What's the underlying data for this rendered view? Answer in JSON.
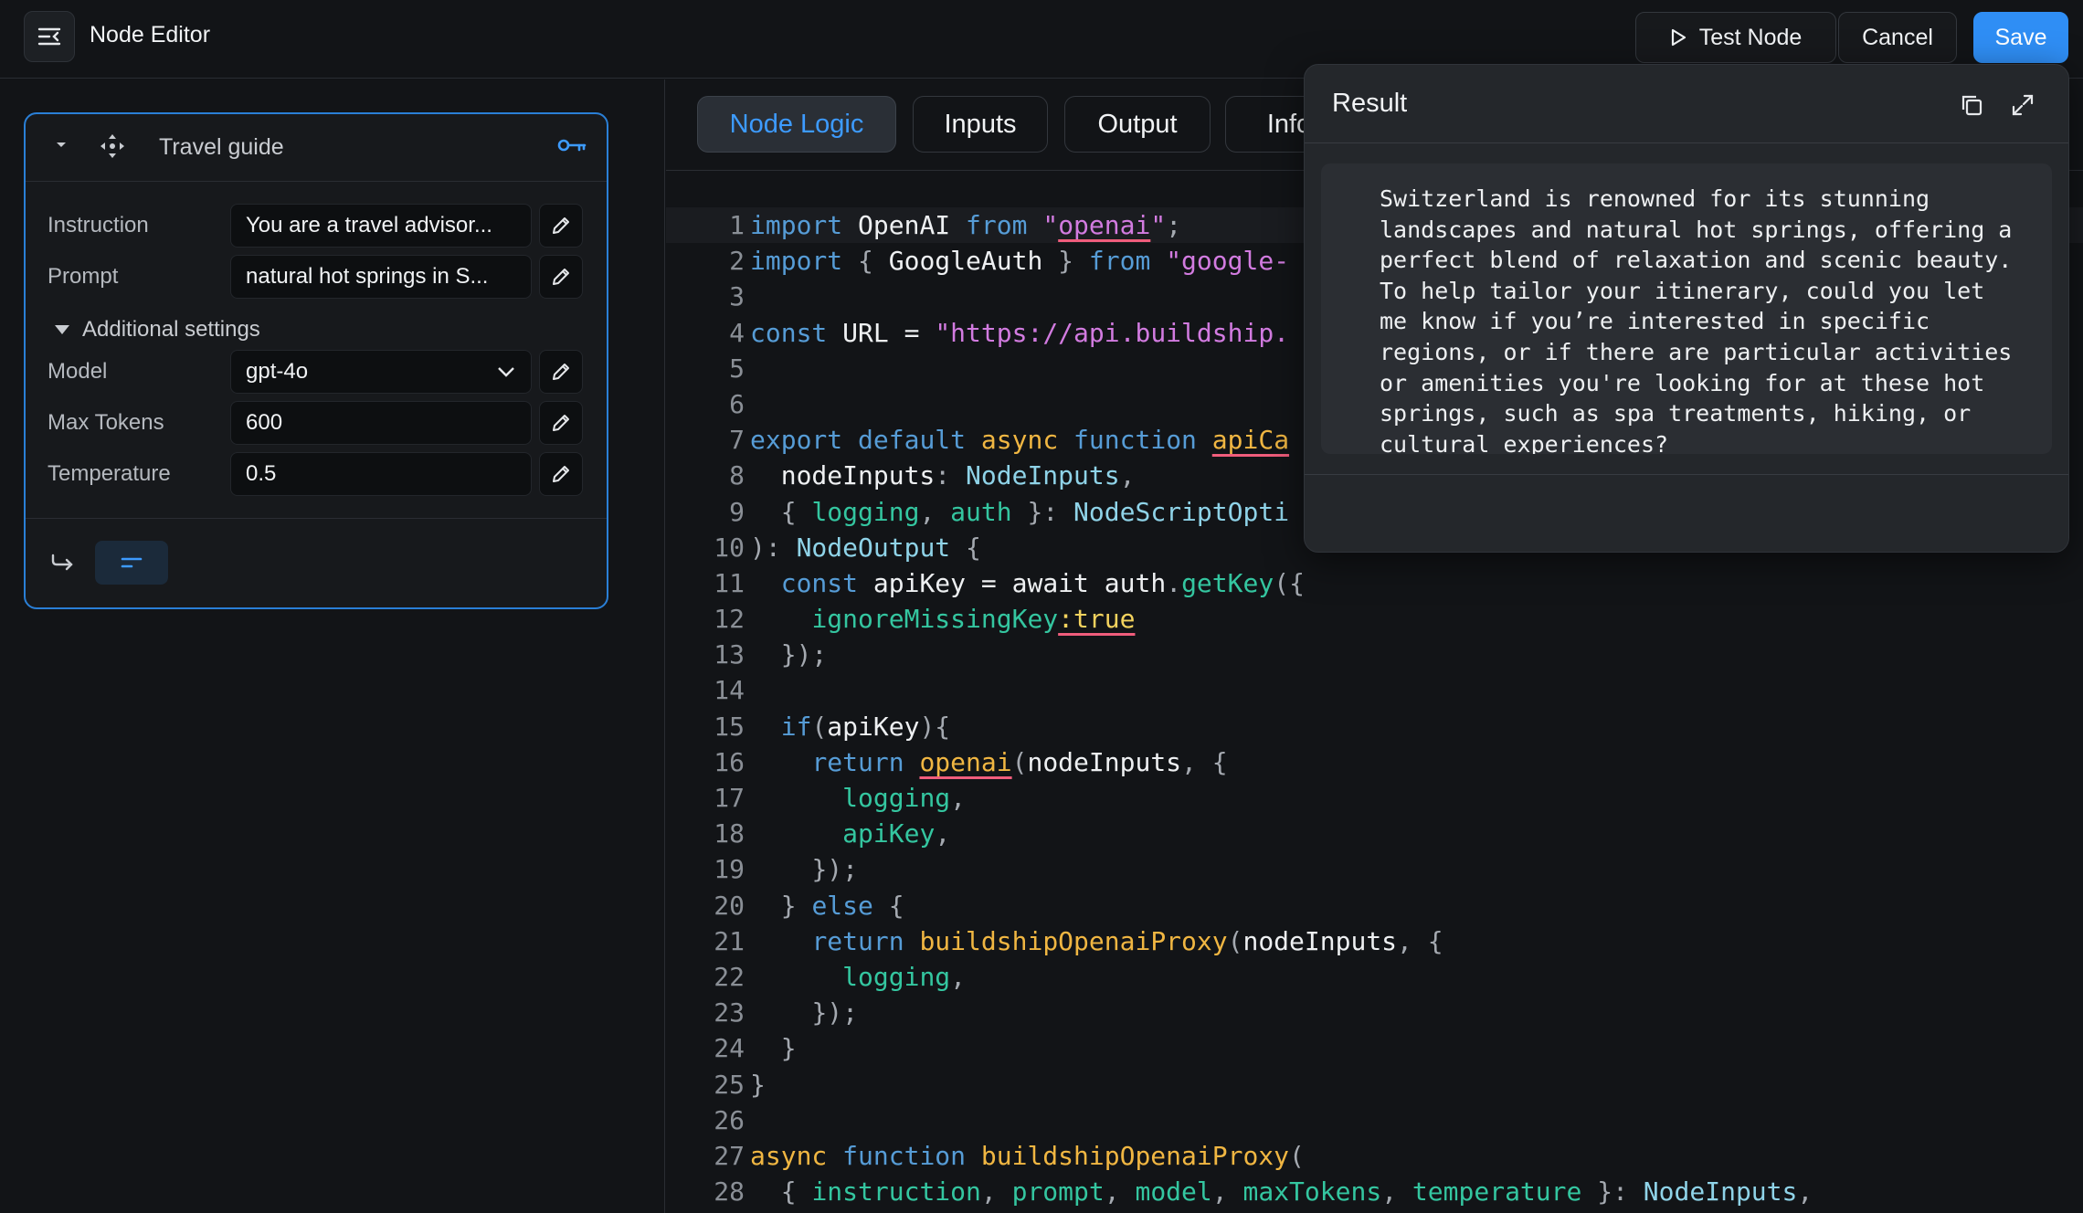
{
  "header": {
    "title": "Node Editor",
    "test_label": "Test Node",
    "cancel_label": "Cancel",
    "save_label": "Save",
    "save_color": "#2f8ef5"
  },
  "node": {
    "name": "Travel guide",
    "fields": {
      "instruction_label": "Instruction",
      "instruction_value": "You are a travel advisor...",
      "prompt_label": "Prompt",
      "prompt_value": "natural hot springs in S...",
      "additional_label": "Additional settings",
      "model_label": "Model",
      "model_value": "gpt-4o",
      "max_tokens_label": "Max Tokens",
      "max_tokens_value": "600",
      "temperature_label": "Temperature",
      "temperature_value": "0.5"
    },
    "icons": [
      "chevron-down-icon",
      "move-icon",
      "key-icon",
      "pencil-icon",
      "return-arrow-icon",
      "text-lines-icon"
    ]
  },
  "tabs": [
    {
      "label": "Node Logic",
      "active": true
    },
    {
      "label": "Inputs"
    },
    {
      "label": "Output"
    },
    {
      "label": "Info"
    }
  ],
  "code_lines": [
    "import OpenAI from \"openai\";",
    "import { GoogleAuth } from \"google-",
    "",
    "const URL = \"https://api.buildship.",
    "",
    "",
    "export default async function apiCa",
    "  nodeInputs: NodeInputs,",
    "  { logging, auth }: NodeScriptOpti",
    "): NodeOutput {",
    "  const apiKey = await auth.getKey({",
    "    ignoreMissingKey:true",
    "  });",
    "",
    "  if(apiKey){",
    "    return openai(nodeInputs, {",
    "      logging,",
    "      apiKey,",
    "    });",
    "  } else {",
    "    return buildshipOpenaiProxy(nodeInputs, {",
    "      logging,",
    "    });",
    "  }",
    "}",
    "",
    "async function buildshipOpenaiProxy(",
    "  { instruction, prompt, model, maxTokens, temperature }: NodeInputs,"
  ],
  "result": {
    "title": "Result",
    "text": "Switzerland is renowned for its stunning landscapes and natural hot springs, offering a perfect blend of relaxation and scenic beauty. To help tailor your itinerary, could you let me know if you’re interested in specific regions, or if there are particular activities or amenities you're looking for at these hot springs, such as spa treatments, hiking, or cultural experiences?"
  }
}
